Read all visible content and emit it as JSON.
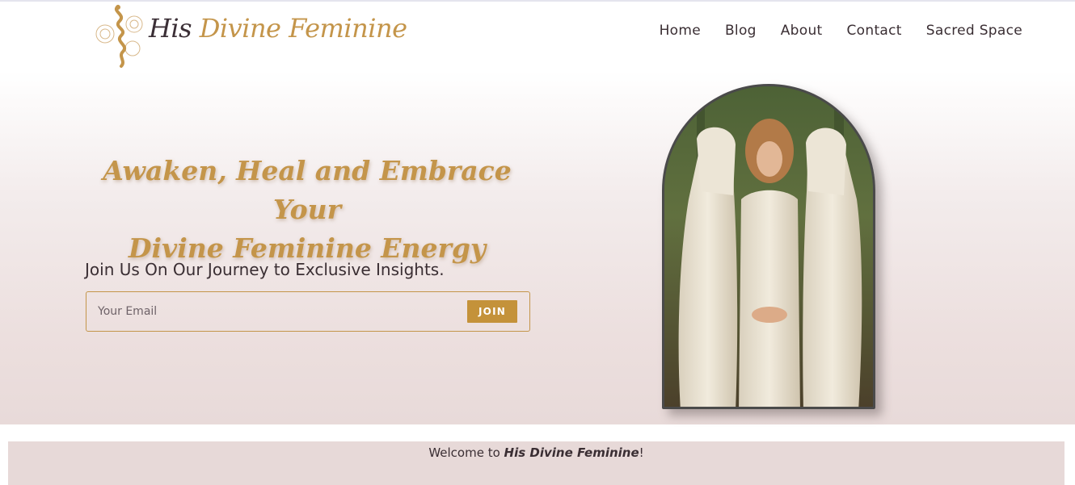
{
  "site": {
    "logo_text_his": "His",
    "logo_text_rest": "Divine Feminine",
    "logo_icon": "serpent-emblem-icon"
  },
  "nav": {
    "items": [
      {
        "label": "Home"
      },
      {
        "label": "Blog"
      },
      {
        "label": "About"
      },
      {
        "label": "Contact"
      },
      {
        "label": "Sacred Space"
      }
    ]
  },
  "hero": {
    "headline_line1": "Awaken, Heal and Embrace Your",
    "headline_line2": "Divine Feminine Energy",
    "subheading": "Join Us On Our Journey to Exclusive Insights.",
    "email_placeholder": "Your Email",
    "join_label": "JOIN"
  },
  "welcome": {
    "prefix": "Welcome to ",
    "site_name": "His Divine Feminine",
    "suffix": "!"
  },
  "colors": {
    "gold": "#c4954a",
    "button_gold": "#c4923a",
    "text_dark": "#3a2e33",
    "band_pink": "#e7d9d8"
  }
}
